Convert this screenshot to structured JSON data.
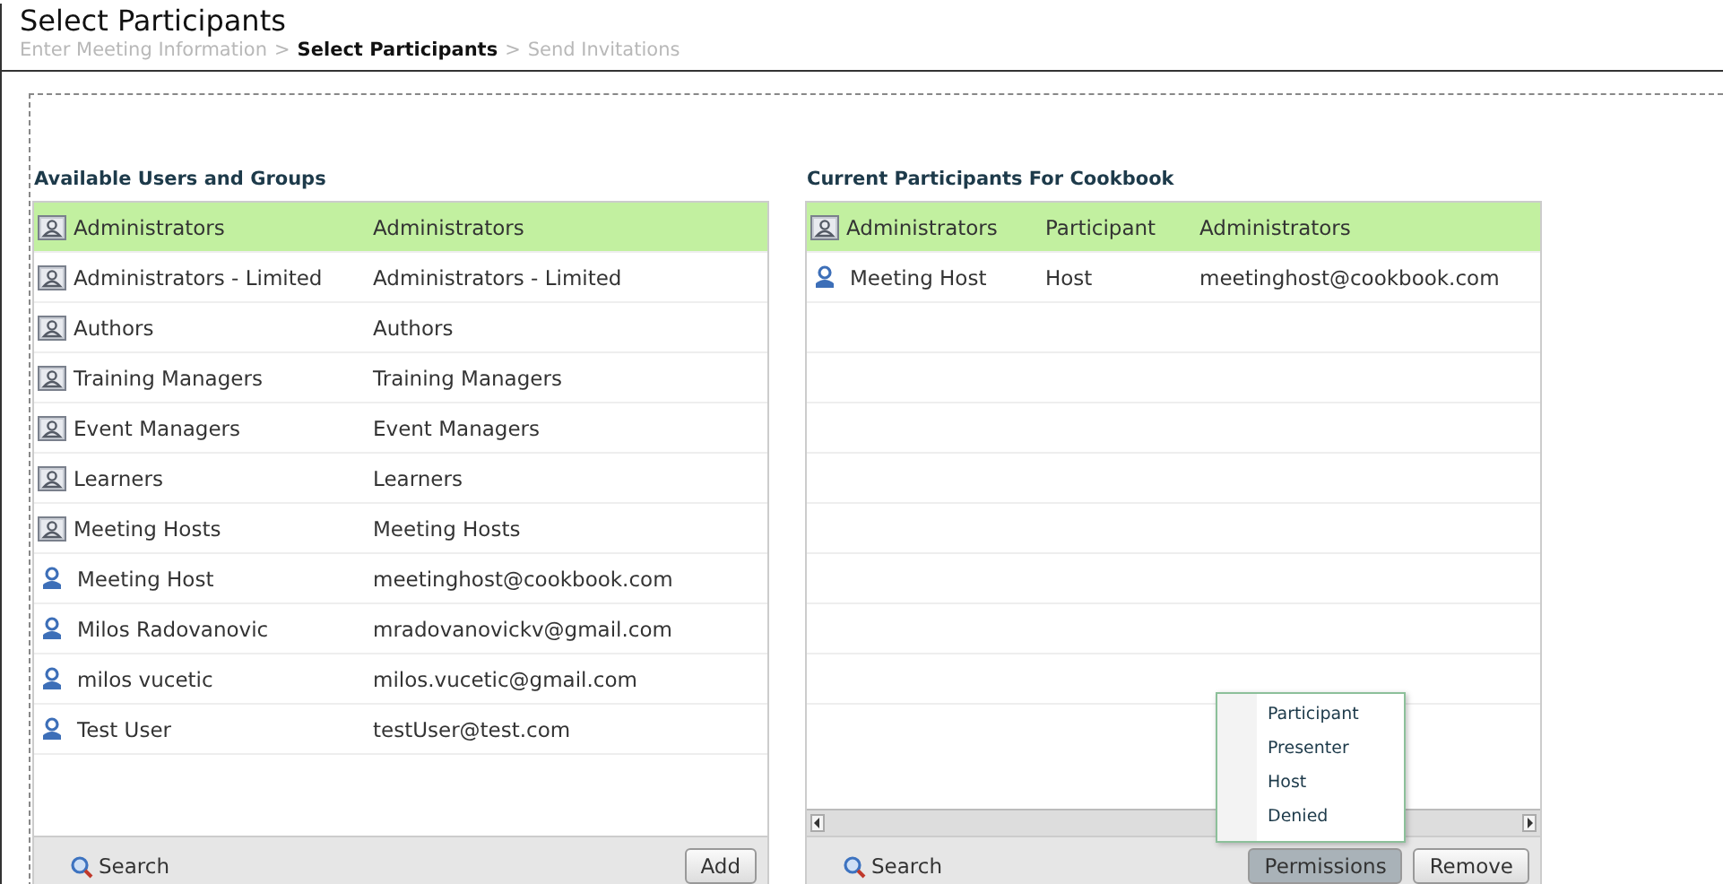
{
  "page_title": "Select Participants",
  "breadcrumb": [
    {
      "label": "Enter Meeting Information",
      "selected": false
    },
    {
      "label": "Select Participants",
      "selected": true
    },
    {
      "label": "Send Invitations",
      "selected": false
    }
  ],
  "breadcrumb_separator": ">",
  "available": {
    "heading": "Available Users and Groups",
    "rows": [
      {
        "kind": "group",
        "name": "Administrators",
        "detail": "Administrators",
        "selected": true
      },
      {
        "kind": "group",
        "name": "Administrators - Limited",
        "detail": "Administrators - Limited",
        "selected": false
      },
      {
        "kind": "group",
        "name": "Authors",
        "detail": "Authors",
        "selected": false
      },
      {
        "kind": "group",
        "name": "Training Managers",
        "detail": "Training Managers",
        "selected": false
      },
      {
        "kind": "group",
        "name": "Event Managers",
        "detail": "Event Managers",
        "selected": false
      },
      {
        "kind": "group",
        "name": "Learners",
        "detail": "Learners",
        "selected": false
      },
      {
        "kind": "group",
        "name": "Meeting Hosts",
        "detail": "Meeting Hosts",
        "selected": false
      },
      {
        "kind": "user",
        "name": "Meeting  Host",
        "detail": "meetinghost@cookbook.com",
        "selected": false
      },
      {
        "kind": "user",
        "name": "Milos Radovanovic",
        "detail": "mradovanovickv@gmail.com",
        "selected": false
      },
      {
        "kind": "user",
        "name": "milos vucetic",
        "detail": "milos.vucetic@gmail.com",
        "selected": false
      },
      {
        "kind": "user",
        "name": "Test User",
        "detail": "testUser@test.com",
        "selected": false
      }
    ],
    "search": "Search",
    "button": "Add"
  },
  "current": {
    "heading": "Current Participants For Cookbook",
    "rows": [
      {
        "kind": "group",
        "name": "Administrators",
        "role": "Participant",
        "detail": "Administrators",
        "selected": true
      },
      {
        "kind": "user",
        "name": "Meeting  Host",
        "role": "Host",
        "detail": "meetinghost@cookbook.com",
        "selected": false
      }
    ],
    "search": "Search",
    "buttons": [
      {
        "label": "Permissions",
        "pressed": true
      },
      {
        "label": "Remove",
        "pressed": false
      }
    ],
    "permissions_menu": [
      "Participant",
      "Presenter",
      "Host",
      "Denied"
    ]
  }
}
